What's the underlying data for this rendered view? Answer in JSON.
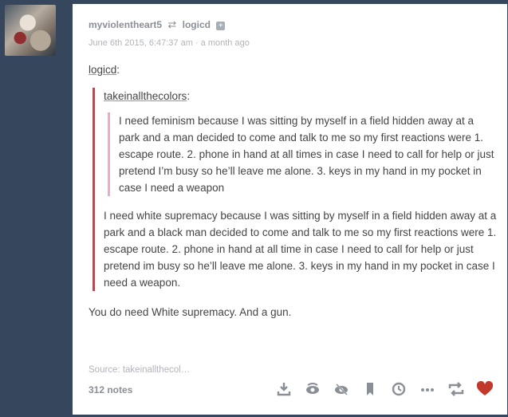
{
  "post": {
    "username": "myviolentheart5",
    "reblog_glyph": "⇄",
    "source_user": "logicd",
    "follow_glyph": "+",
    "timestamp": "June 6th 2015, 6:47:37 am · a month ago",
    "reblogger": "logicd",
    "colon": ":",
    "quote_user": "takeinallthecolors",
    "inner_text": "I need feminism because I was sitting by myself in a field hidden away at a park and a man decided to come and talk to me so my first reactions were 1. escape route. 2. phone in hand at all times in case I need to call for help or just pretend I’m busy so he’ll leave me alone.  3. keys in my hand in my pocket in case I need a weapon",
    "outer_text": "I need white supremacy because I was sitting by myself in a field hidden away at a park and a black man decided to come and talk to me so my first reactions were 1. escape route. 2. phone in hand at all time in case I need to call for help or just pretend im busy so he’ll leave me alone. 3. keys in my hand in my pocket in case I need a weapon.",
    "comment": "You do need White supremacy.  And a gun.",
    "source": "Source: takeinallthecol…",
    "notes": "312 notes"
  },
  "actions": {
    "icons": [
      "download-icon",
      "eye-incognito-icon",
      "eye-slash-icon",
      "bookmark-icon",
      "history-icon",
      "more-icon",
      "reblog-icon",
      "like-heart-icon"
    ]
  },
  "colors": {
    "background": "#36465d",
    "like": "#c0392b",
    "outer_quote_border": "#b14b54",
    "inner_quote_border": "#f0a7c9"
  }
}
